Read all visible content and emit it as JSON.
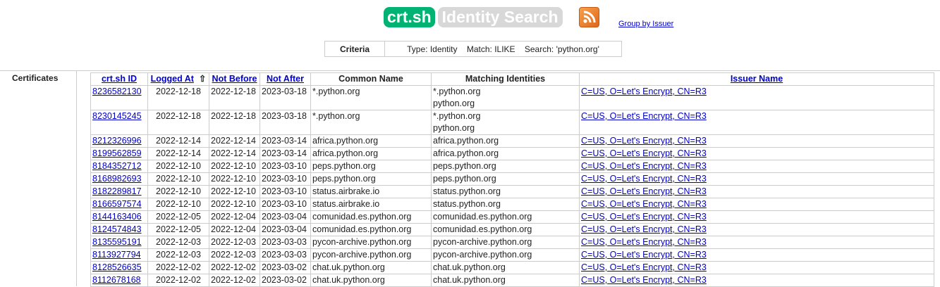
{
  "header": {
    "logo": "crt.sh",
    "title": "Identity Search",
    "rss_icon": "rss-icon",
    "group_link": "Group by Issuer"
  },
  "criteria": {
    "label": "Criteria",
    "value": "Type: Identity    Match: ILIKE    Search: 'python.org'"
  },
  "section_label": "Certificates",
  "columns": [
    "crt.sh ID",
    "Logged At",
    "Not Before",
    "Not After",
    "Common Name",
    "Matching Identities",
    "Issuer Name"
  ],
  "sort_indicator": "⇧",
  "rows": [
    [
      "8236582130",
      "2022-12-18",
      "2022-12-18",
      "2023-03-18",
      "*.python.org",
      [
        "*.python.org",
        "python.org"
      ],
      "C=US, O=Let's Encrypt, CN=R3"
    ],
    [
      "8230145245",
      "2022-12-18",
      "2022-12-18",
      "2023-03-18",
      "*.python.org",
      [
        "*.python.org",
        "python.org"
      ],
      "C=US, O=Let's Encrypt, CN=R3"
    ],
    [
      "8212326996",
      "2022-12-14",
      "2022-12-14",
      "2023-03-14",
      "africa.python.org",
      [
        "africa.python.org"
      ],
      "C=US, O=Let's Encrypt, CN=R3"
    ],
    [
      "8199562859",
      "2022-12-14",
      "2022-12-14",
      "2023-03-14",
      "africa.python.org",
      [
        "africa.python.org"
      ],
      "C=US, O=Let's Encrypt, CN=R3"
    ],
    [
      "8184352712",
      "2022-12-10",
      "2022-12-10",
      "2023-03-10",
      "peps.python.org",
      [
        "peps.python.org"
      ],
      "C=US, O=Let's Encrypt, CN=R3"
    ],
    [
      "8168982693",
      "2022-12-10",
      "2022-12-10",
      "2023-03-10",
      "peps.python.org",
      [
        "peps.python.org"
      ],
      "C=US, O=Let's Encrypt, CN=R3"
    ],
    [
      "8182289817",
      "2022-12-10",
      "2022-12-10",
      "2023-03-10",
      "status.airbrake.io",
      [
        "status.python.org"
      ],
      "C=US, O=Let's Encrypt, CN=R3"
    ],
    [
      "8166597574",
      "2022-12-10",
      "2022-12-10",
      "2023-03-10",
      "status.airbrake.io",
      [
        "status.python.org"
      ],
      "C=US, O=Let's Encrypt, CN=R3"
    ],
    [
      "8144163406",
      "2022-12-05",
      "2022-12-04",
      "2023-03-04",
      "comunidad.es.python.org",
      [
        "comunidad.es.python.org"
      ],
      "C=US, O=Let's Encrypt, CN=R3"
    ],
    [
      "8124574843",
      "2022-12-05",
      "2022-12-04",
      "2023-03-04",
      "comunidad.es.python.org",
      [
        "comunidad.es.python.org"
      ],
      "C=US, O=Let's Encrypt, CN=R3"
    ],
    [
      "8135595191",
      "2022-12-03",
      "2022-12-03",
      "2023-03-03",
      "pycon-archive.python.org",
      [
        "pycon-archive.python.org"
      ],
      "C=US, O=Let's Encrypt, CN=R3"
    ],
    [
      "8113927794",
      "2022-12-03",
      "2022-12-03",
      "2023-03-03",
      "pycon-archive.python.org",
      [
        "pycon-archive.python.org"
      ],
      "C=US, O=Let's Encrypt, CN=R3"
    ],
    [
      "8128526635",
      "2022-12-02",
      "2022-12-02",
      "2023-03-02",
      "chat.uk.python.org",
      [
        "chat.uk.python.org"
      ],
      "C=US, O=Let's Encrypt, CN=R3"
    ],
    [
      "8112678168",
      "2022-12-02",
      "2022-12-02",
      "2023-03-02",
      "chat.uk.python.org",
      [
        "chat.uk.python.org"
      ],
      "C=US, O=Let's Encrypt, CN=R3"
    ]
  ]
}
